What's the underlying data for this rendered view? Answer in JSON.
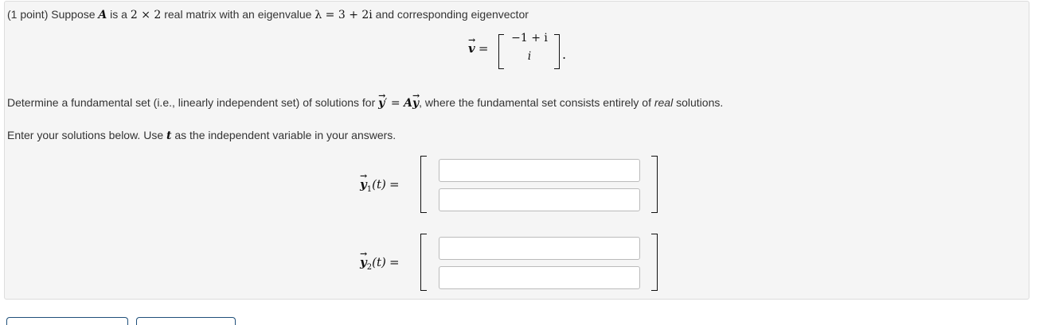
{
  "problem": {
    "intro": {
      "points": "(1 point)",
      "t1": " Suppose ",
      "A": "A",
      "t2": " is a ",
      "dim": "2 × 2",
      "t3": " real matrix with an eigenvalue ",
      "lambda_eq": "λ = 3 + 2i",
      "t4": " and corresponding eigenvector"
    },
    "eigenvector": {
      "symbol": "v",
      "arrow": "→",
      "equals": "=",
      "entry1": "−1 + i",
      "entry2": "i",
      "period": "."
    },
    "determine": {
      "t1": "Determine a fundamental set (i.e., linearly independent set) of solutions for ",
      "ysym": "y",
      "prime": "′",
      "eq": " = ",
      "A": "A",
      "t2": ", where the fundamental set consists entirely of ",
      "real": "real",
      "t3": " solutions."
    },
    "enter": {
      "t1": "Enter your solutions below. Use ",
      "t": "t",
      "t2": " as the independent variable in your answers."
    }
  },
  "solutions": [
    {
      "symbol": "y",
      "sub": "1",
      "arg": "(t)",
      "equals": "=",
      "entry1": "",
      "entry2": ""
    },
    {
      "symbol": "y",
      "sub": "2",
      "arg": "(t)",
      "equals": "=",
      "entry1": "",
      "entry2": ""
    }
  ],
  "colors": {
    "panel_bg": "#f5f5f5",
    "panel_border": "#dddddd",
    "button_border": "#1f4f7a"
  }
}
